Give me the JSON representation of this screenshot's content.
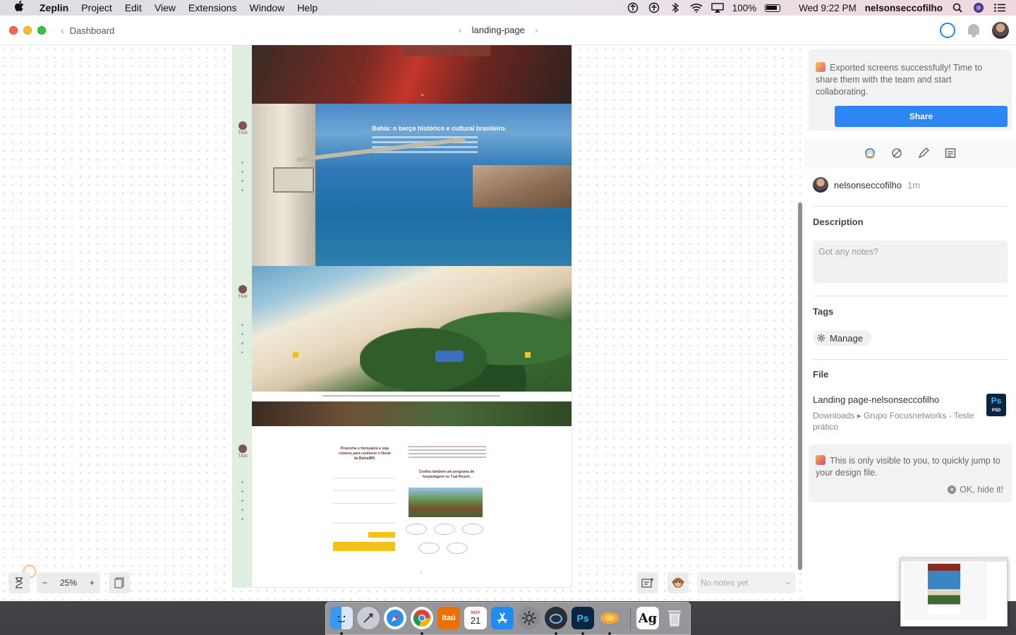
{
  "menubar": {
    "app_name": "Zeplin",
    "menus": [
      "Project",
      "Edit",
      "View",
      "Extensions",
      "Window",
      "Help"
    ],
    "battery": "100%",
    "clock": "Wed 9:22 PM",
    "username": "nelsonseccofilho"
  },
  "titlebar": {
    "back_label": "Dashboard",
    "screen_name": "landing-page"
  },
  "artboard": {
    "hero_title": "Bahia: o berço histórico e cultural brasileiro.",
    "form_heading": "Preencha o formulário e veja roteiros para conhecer o litoral da Bahia/BR.",
    "confira_heading": "Confira também um programa de hospedagem no Txai Resort.",
    "logo_text": "TXAI"
  },
  "toolbar": {
    "zoom_level": "25%",
    "zoom_out": "−",
    "zoom_in": "+",
    "notes_placeholder": "No notes yet"
  },
  "panel": {
    "export_message": "Exported screens successfully! Time to share them with the team and start collaborating.",
    "share_label": "Share",
    "author": "nelsonseccofilho",
    "author_time": "1m",
    "description_heading": "Description",
    "description_placeholder": "Got any notes?",
    "tags_heading": "Tags",
    "manage_label": "Manage",
    "file_heading": "File",
    "file_name": "Landing page-nelsonseccofilho",
    "file_path": "Downloads ▸ Grupo Focusnetworks - Teste prático",
    "file_badge": "Ps",
    "file_badge_sub": "PSD",
    "private_message": "This is only visible to you, to quickly jump to your design file.",
    "hide_label": "OK, hide it!"
  },
  "dock": {
    "itau_label": "itaú",
    "calendar_month": "NOV",
    "calendar_day": "21",
    "ps_label": "Ps",
    "font_label": "Ag"
  },
  "colors": {
    "accent": "#2e86f5",
    "ring": "#1c86f2"
  }
}
